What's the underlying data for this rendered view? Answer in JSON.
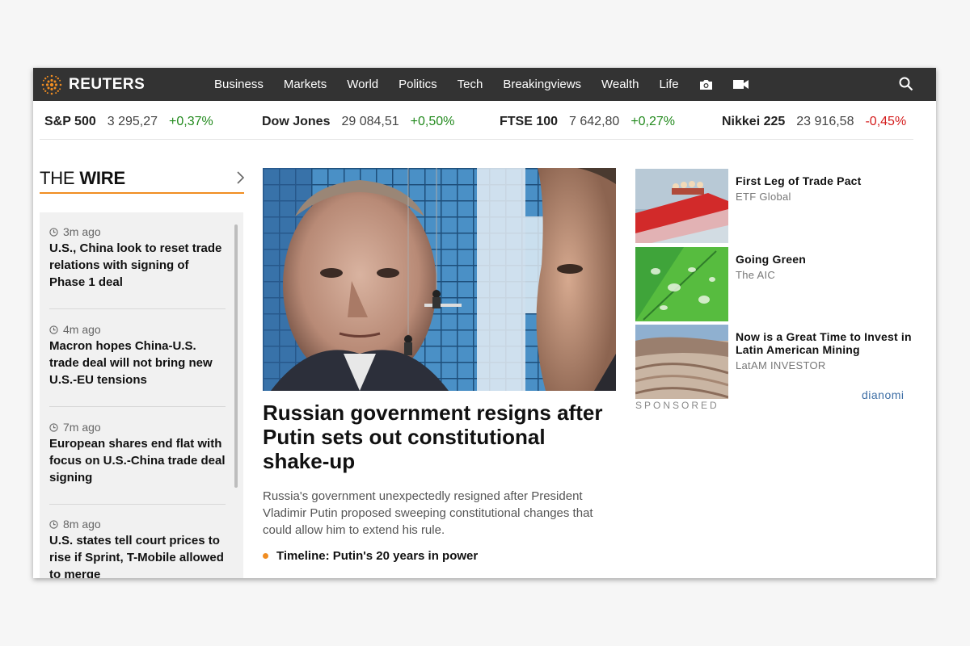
{
  "brand": {
    "name": "REUTERS",
    "accent": "#f08d22"
  },
  "nav": {
    "items": [
      "Business",
      "Markets",
      "World",
      "Politics",
      "Tech",
      "Breakingviews",
      "Wealth",
      "Life"
    ],
    "icons": [
      "camera-icon",
      "video-icon",
      "search-icon"
    ]
  },
  "ticker": [
    {
      "name": "S&P 500",
      "value": "3 295,27",
      "change": "+0,37%",
      "direction": "up"
    },
    {
      "name": "Dow Jones",
      "value": "29 084,51",
      "change": "+0,50%",
      "direction": "up"
    },
    {
      "name": "FTSE 100",
      "value": "7 642,80",
      "change": "+0,27%",
      "direction": "up"
    },
    {
      "name": "Nikkei 225",
      "value": "23 916,58",
      "change": "-0,45%",
      "direction": "down"
    }
  ],
  "wire": {
    "title_light": "THE ",
    "title_bold": "WIRE",
    "items": [
      {
        "time": "3m ago",
        "headline": "U.S., China look to reset trade relations with signing of Phase 1 deal"
      },
      {
        "time": "4m ago",
        "headline": "Macron hopes China-U.S. trade deal will not bring new U.S.-EU tensions"
      },
      {
        "time": "7m ago",
        "headline": "European shares end flat with focus on U.S.-China trade deal signing"
      },
      {
        "time": "8m ago",
        "headline": "U.S. states tell court prices to rise if Sprint, T-Mobile allowed to merge"
      }
    ]
  },
  "hero": {
    "title": "Russian government resigns after Putin sets out constitutional shake-up",
    "summary": "Russia's government unexpectedly resigned after President Vladimir Putin proposed sweeping constitutional changes that could allow him to extend his rule.",
    "related": "Timeline: Putin's 20 years in power"
  },
  "sponsored": {
    "label": "SPONSORED",
    "provider": "dianomi",
    "items": [
      {
        "title": "First Leg of Trade Pact",
        "source": "ETF Global"
      },
      {
        "title": "Going Green",
        "source": "The AIC"
      },
      {
        "title": "Now is a Great Time to Invest in Latin American Mining",
        "source": "LatAM INVESTOR"
      }
    ]
  }
}
